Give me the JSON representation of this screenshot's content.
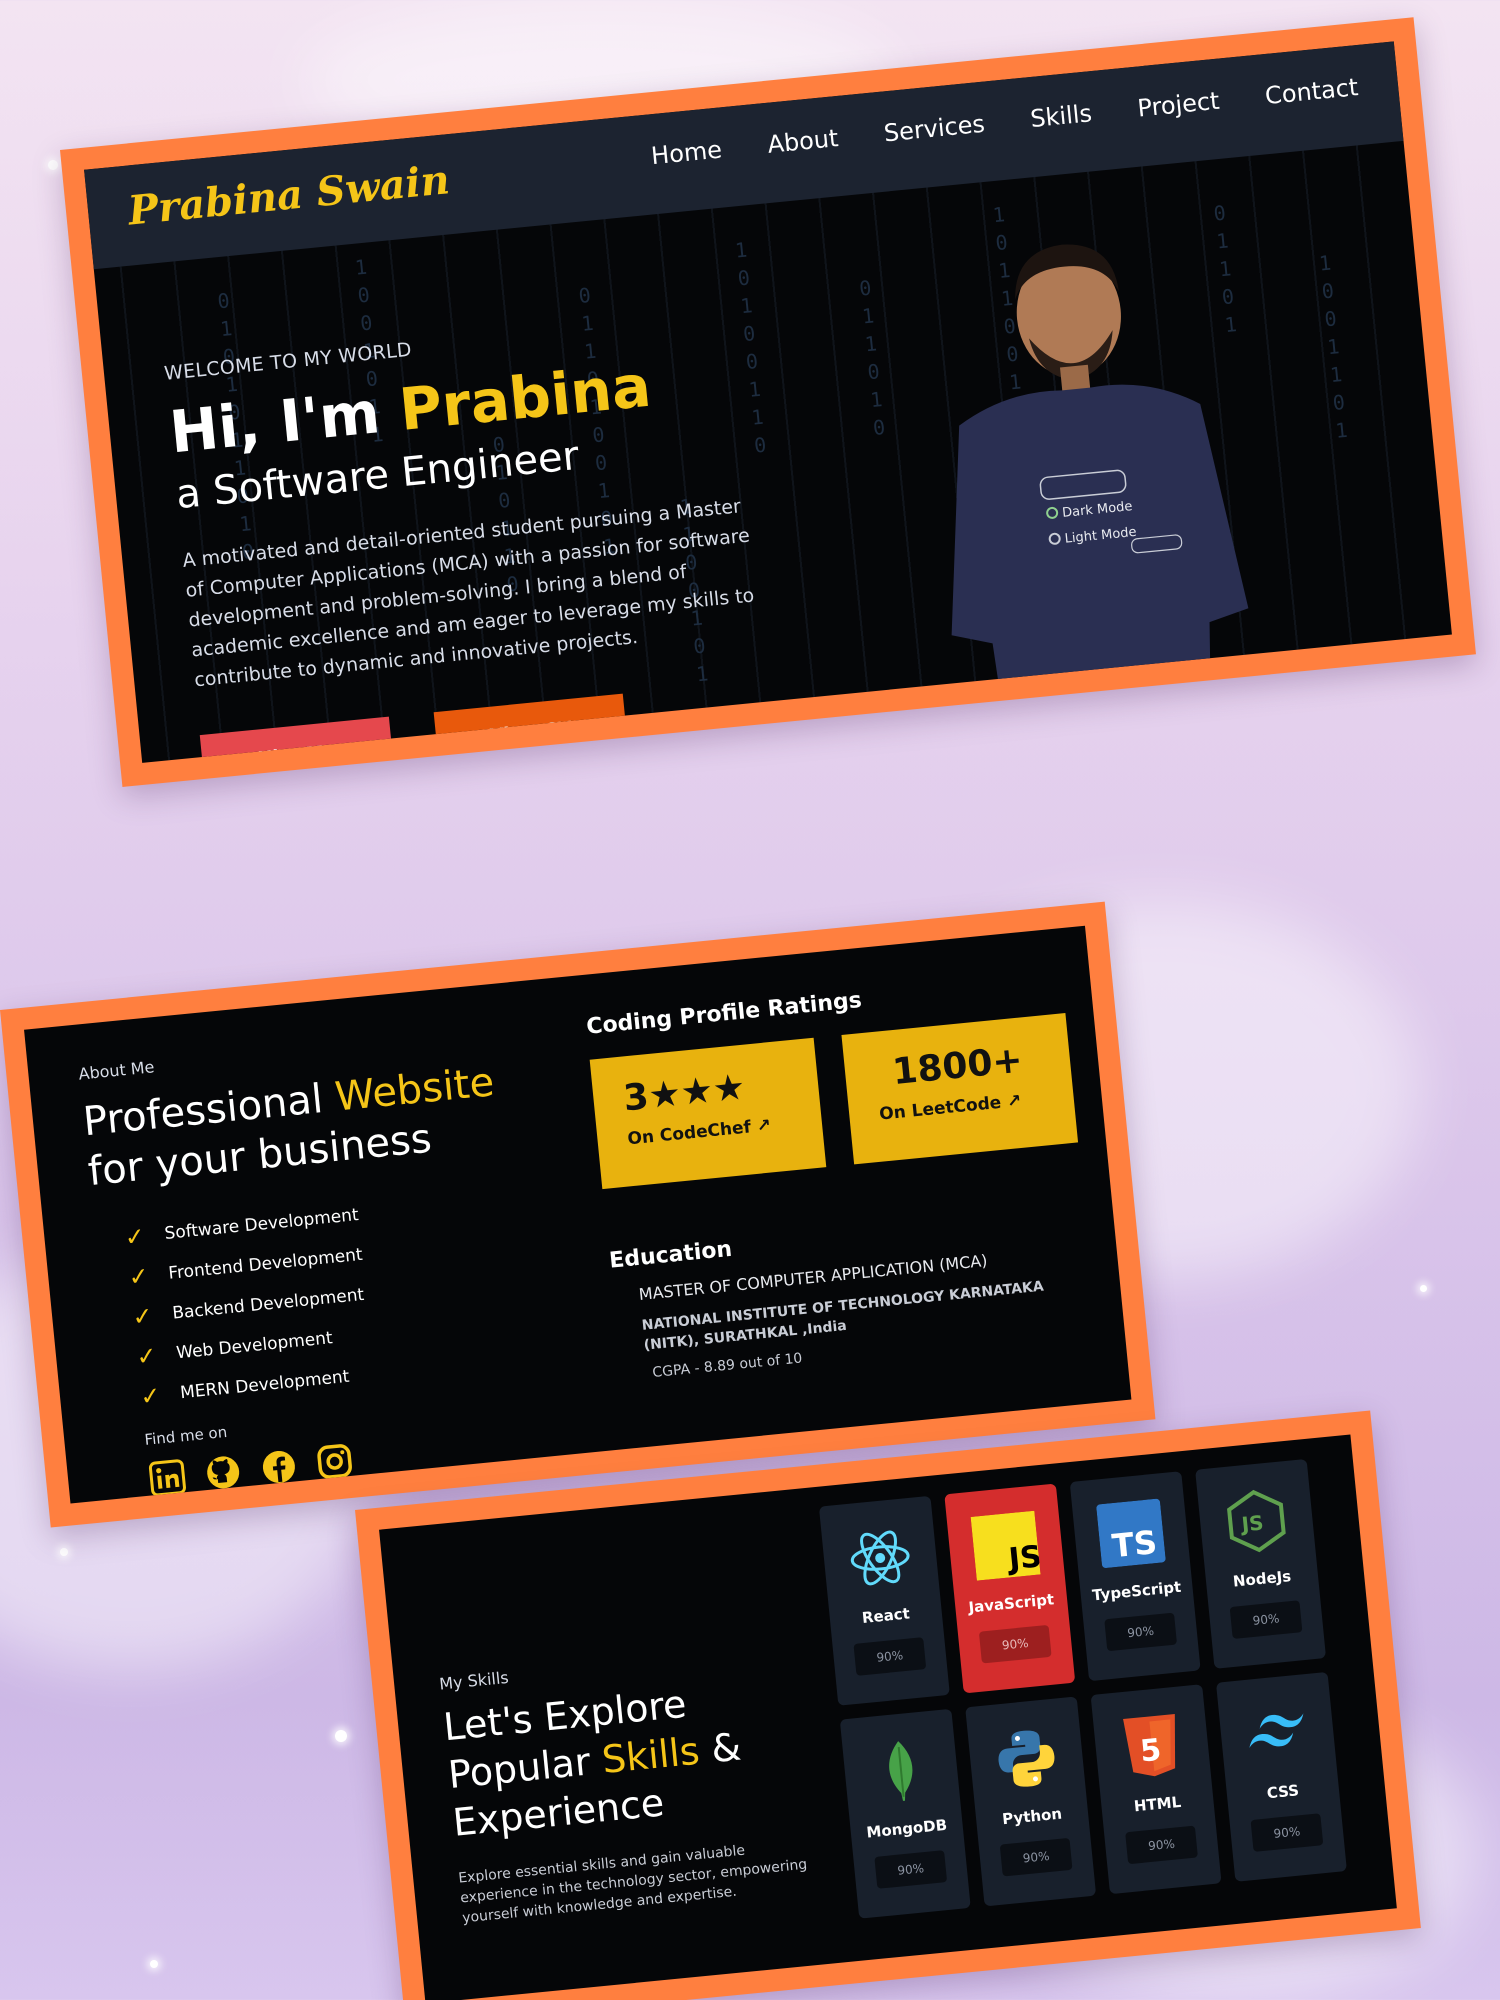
{
  "hero": {
    "logo": "Prabina Swain",
    "nav": [
      "Home",
      "About",
      "Services",
      "Skills",
      "Project",
      "Contact"
    ],
    "welcome": "WELCOME TO MY WORLD",
    "greeting": "Hi, I'm ",
    "name": "Prabina",
    "role": "a Software Engineer",
    "description": "A motivated and detail-oriented student pursuing a Master of Computer Applications (MCA) with a passion for software development and problem-solving. I bring a blend of academic excellence and am eager to leverage my skills to contribute to dynamic and innovative projects.",
    "hire_label": "Hire Me",
    "cv_label": "View CV",
    "shirt_dark": "Dark Mode",
    "shirt_light": "Light Mode"
  },
  "about": {
    "label": "About Me",
    "title_part1": "Professional ",
    "title_highlight": "Website",
    "title_part2": "for your business",
    "services": [
      "Software Development",
      "Frontend Development",
      "Backend Development",
      "Web Development",
      "MERN Development"
    ],
    "find_label": "Find me on",
    "socials": [
      "linkedin-icon",
      "github-icon",
      "facebook-icon",
      "instagram-icon"
    ],
    "ratings_title": "Coding Profile Ratings",
    "ratings": [
      {
        "value": "3★★★",
        "platform": "On CodeChef"
      },
      {
        "value": "1800+",
        "platform": "On LeetCode"
      }
    ],
    "education_title": "Education",
    "degree": "MASTER OF COMPUTER APPLICATION (MCA)",
    "institute": "NATIONAL INSTITUTE OF TECHNOLOGY KARNATAKA (NITK), SURATHKAL ,India",
    "cgpa": "CGPA - 8.89 out of 10"
  },
  "skills": {
    "label": "My Skills",
    "title_part1": "Let's Explore Popular ",
    "title_highlight": "Skills",
    "title_part2": " & Experience",
    "description": "Explore essential skills and gain valuable experience in the technology sector, empowering yourself with knowledge and expertise.",
    "items": [
      {
        "name": "React",
        "percent": "90%"
      },
      {
        "name": "JavaScript",
        "percent": "90%"
      },
      {
        "name": "TypeScript",
        "percent": "90%"
      },
      {
        "name": "NodeJs",
        "percent": "90%"
      },
      {
        "name": "MongoDB",
        "percent": "90%"
      },
      {
        "name": "Python",
        "percent": "90%"
      },
      {
        "name": "HTML",
        "percent": "90%"
      },
      {
        "name": "CSS",
        "percent": "90%"
      }
    ]
  },
  "colors": {
    "accent": "#f5c518",
    "frame": "#ff7f3f",
    "hire": "#e5484d",
    "cv": "#e8590c",
    "active_skill": "#d42d2d"
  }
}
